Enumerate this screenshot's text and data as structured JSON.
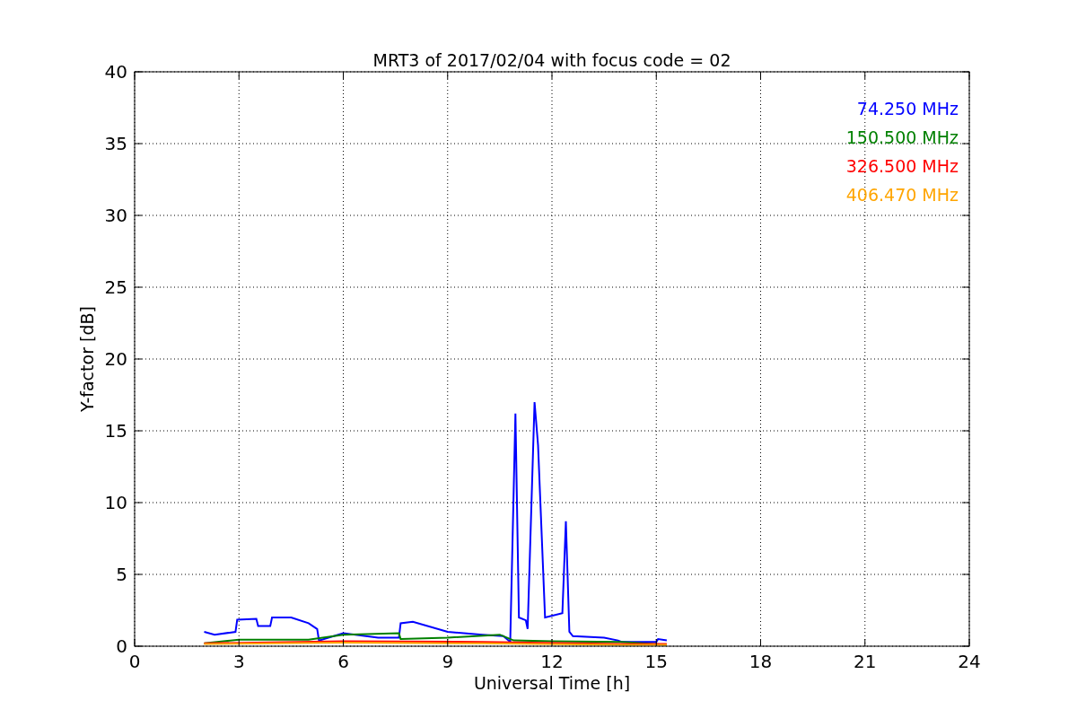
{
  "chart_data": {
    "type": "line",
    "title": "MRT3 of 2017/02/04 with focus code = 02",
    "xlabel": "Universal Time [h]",
    "ylabel": "Y-factor [dB]",
    "xlim": [
      0,
      24
    ],
    "ylim": [
      0,
      40
    ],
    "grid": true,
    "xticks": [
      0,
      3,
      6,
      9,
      12,
      15,
      18,
      21,
      24
    ],
    "yticks": [
      0,
      5,
      10,
      15,
      20,
      25,
      30,
      35,
      40
    ],
    "series": [
      {
        "name": "74.250 MHz",
        "color": "#0000ff",
        "x": [
          2.0,
          2.3,
          2.9,
          2.95,
          3.5,
          3.55,
          3.9,
          3.95,
          4.5,
          5.0,
          5.25,
          5.3,
          6.0,
          7.0,
          7.6,
          7.65,
          8.0,
          9.0,
          10.0,
          10.6,
          10.8,
          10.95,
          11.05,
          11.25,
          11.3,
          11.5,
          11.6,
          11.8,
          12.3,
          12.4,
          12.5,
          12.6,
          13.5,
          13.9,
          14.0,
          15.0,
          15.05,
          15.3
        ],
        "values": [
          1.0,
          0.8,
          1.0,
          1.85,
          1.9,
          1.4,
          1.4,
          2.0,
          2.0,
          1.6,
          1.2,
          0.4,
          0.9,
          0.6,
          0.6,
          1.6,
          1.7,
          1.0,
          0.8,
          0.7,
          0.3,
          16.2,
          2.0,
          1.8,
          1.2,
          17.0,
          14.0,
          2.0,
          2.3,
          8.7,
          1.0,
          0.7,
          0.6,
          0.4,
          0.3,
          0.3,
          0.5,
          0.4
        ]
      },
      {
        "name": "150.500 MHz",
        "color": "#008000",
        "x": [
          2.0,
          3.0,
          5.0,
          6.0,
          7.6,
          7.65,
          9.0,
          10.5,
          10.9,
          12.0,
          14.0,
          15.3
        ],
        "values": [
          0.2,
          0.45,
          0.45,
          0.8,
          0.9,
          0.5,
          0.6,
          0.8,
          0.4,
          0.35,
          0.3,
          0.1
        ]
      },
      {
        "name": "326.500 MHz",
        "color": "#ff0000",
        "x": [
          2.0,
          6.0,
          10.0,
          14.0,
          15.3
        ],
        "values": [
          0.2,
          0.35,
          0.3,
          0.15,
          0.15
        ]
      },
      {
        "name": "406.470 MHz",
        "color": "#ffa500",
        "x": [
          2.0,
          6.0,
          10.0,
          14.0,
          15.3
        ],
        "values": [
          0.15,
          0.25,
          0.2,
          0.1,
          0.1
        ]
      }
    ]
  }
}
